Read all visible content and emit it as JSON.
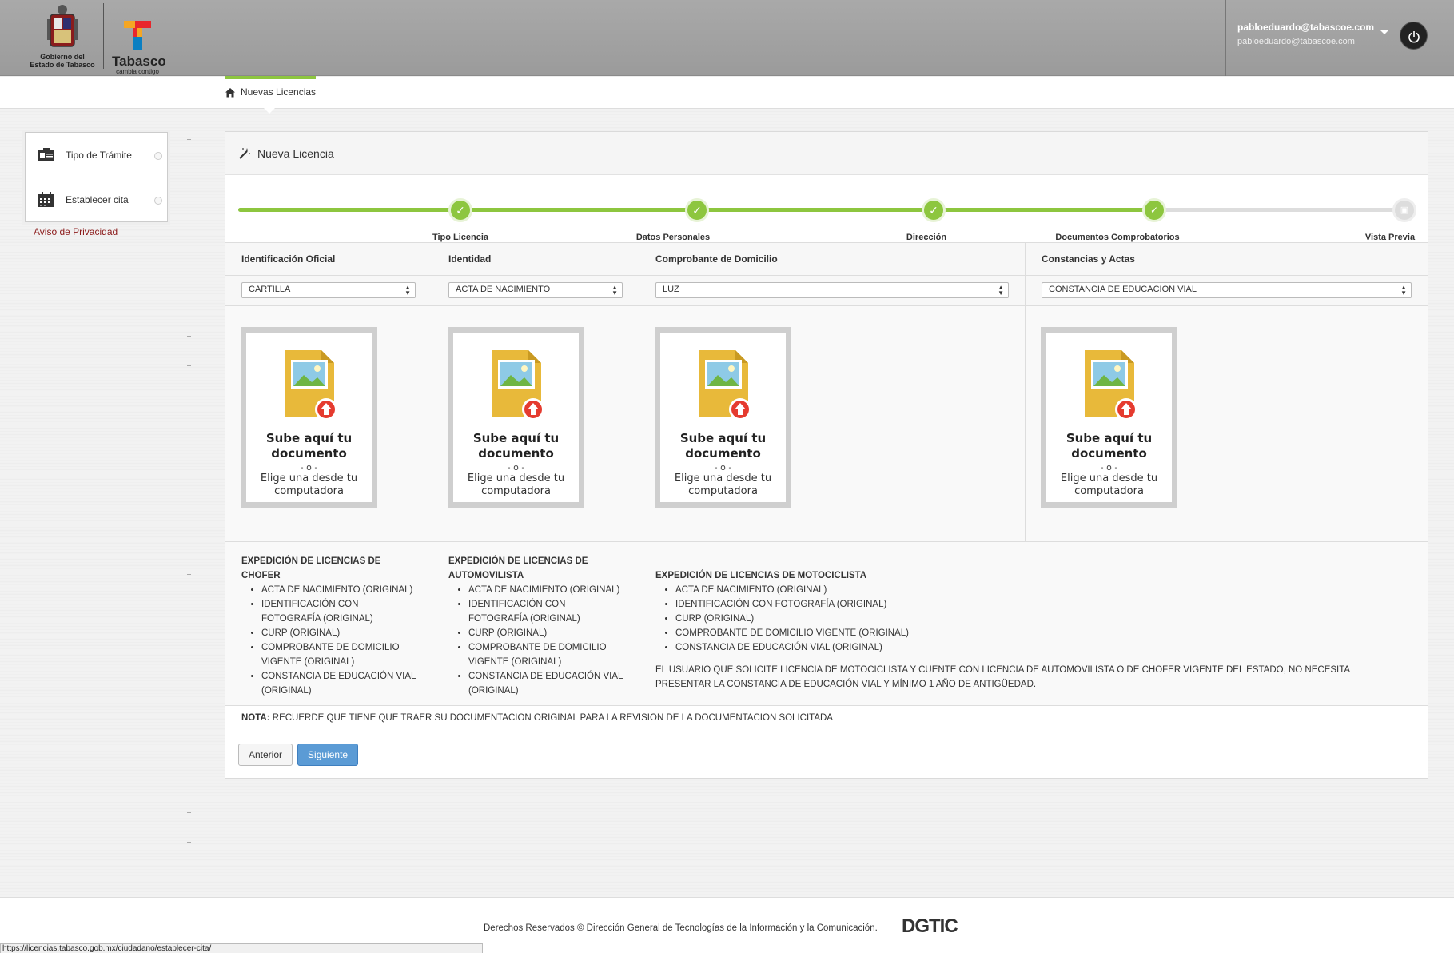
{
  "header": {
    "gov_logo_text": "Gobierno del\nEstado de Tabasco",
    "gov_logo_line1": "Gobierno del",
    "gov_logo_line2": "Estado de Tabasco",
    "brand_name": "Tabasco",
    "brand_tagline": "cambia contigo",
    "user_email": "pabloeduardo@tabascoe.com",
    "user_email_secondary": "pabloeduardo@tabascoe.com"
  },
  "breadcrumb": {
    "label": "Nuevas Licencias"
  },
  "sidebar": {
    "items": [
      {
        "label": "Tipo de Trámite",
        "icon": "id-card-icon"
      },
      {
        "label": "Establecer cita",
        "icon": "calendar-icon"
      }
    ],
    "privacy_link": "Aviso de Privacidad"
  },
  "panel": {
    "title": "Nueva Licencia",
    "steps": [
      {
        "label": "Tipo Licencia",
        "status": "done"
      },
      {
        "label": "Datos Personales",
        "status": "done"
      },
      {
        "label": "Dirección",
        "status": "done"
      },
      {
        "label": "Documentos Comprobatorios",
        "status": "current"
      },
      {
        "label": "Vista Previa",
        "status": "pending"
      }
    ],
    "columns": [
      {
        "header": "Identificación Oficial",
        "selected": "CARTILLA"
      },
      {
        "header": "Identidad",
        "selected": "ACTA DE NACIMIENTO"
      },
      {
        "header": "Comprobante de Domicilio",
        "selected": "LUZ"
      },
      {
        "header": "Constancias y Actas",
        "selected": "CONSTANCIA DE EDUCACION VIAL"
      }
    ],
    "upload": {
      "title": "Sube aquí tu documento",
      "or": "- o -",
      "subtitle": "Elige una desde tu computadora"
    },
    "requirements": [
      {
        "title": "EXPEDICIÓN DE LICENCIAS DE CHOFER",
        "items": [
          "ACTA DE NACIMIENTO (ORIGINAL)",
          "IDENTIFICACIÓN CON FOTOGRAFÍA (ORIGINAL)",
          "CURP (ORIGINAL)",
          "COMPROBANTE DE DOMICILIO VIGENTE (ORIGINAL)",
          "CONSTANCIA DE EDUCACIÓN VIAL (ORIGINAL)"
        ]
      },
      {
        "title": "EXPEDICIÓN DE LICENCIAS DE AUTOMOVILISTA",
        "items": [
          "ACTA DE NACIMIENTO (ORIGINAL)",
          "IDENTIFICACIÓN CON FOTOGRAFÍA (ORIGINAL)",
          "CURP (ORIGINAL)",
          "COMPROBANTE DE DOMICILIO VIGENTE (ORIGINAL)",
          "CONSTANCIA DE EDUCACIÓN VIAL (ORIGINAL)"
        ]
      },
      {
        "title": "EXPEDICIÓN DE LICENCIAS DE MOTOCICLISTA",
        "items": [
          "ACTA DE NACIMIENTO (ORIGINAL)",
          "IDENTIFICACIÓN CON FOTOGRAFÍA (ORIGINAL)",
          "CURP (ORIGINAL)",
          "COMPROBANTE DE DOMICILIO VIGENTE (ORIGINAL)",
          "CONSTANCIA DE EDUCACIÓN VIAL (ORIGINAL)"
        ],
        "note": "EL USUARIO QUE SOLICITE LICENCIA DE MOTOCICLISTA Y CUENTE CON LICENCIA DE AUTOMOVILISTA O DE CHOFER VIGENTE DEL ESTADO, NO NECESITA PRESENTAR LA CONSTANCIA DE EDUCACIÓN VIAL Y MÍNIMO 1 AÑO DE ANTIGÜEDAD."
      }
    ],
    "note_label": "NOTA:",
    "note_text": "RECUERDE QUE TIENE QUE TRAER SU DOCUMENTACION ORIGINAL PARA LA REVISION DE LA DOCUMENTACION SOLICITADA",
    "prev_button": "Anterior",
    "next_button": "Siguiente"
  },
  "footer": {
    "text": "Derechos Reservados © Dirección General de Tecnologías de la Información y la Comunicación.",
    "logo": "DGTIC"
  },
  "status_bar": {
    "url": "https://licencias.tabasco.gob.mx/ciudadano/establecer-cita/"
  },
  "colors": {
    "accent_green": "#8dc63f",
    "primary_button": "#5b9bd5",
    "privacy_link": "#8b1a1a"
  }
}
